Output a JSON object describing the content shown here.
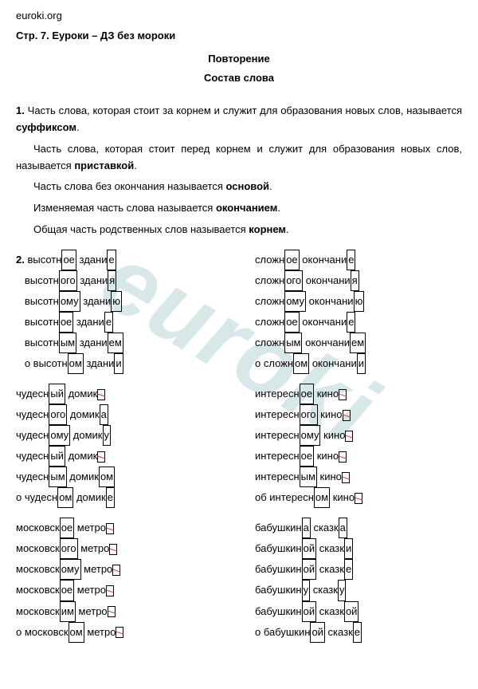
{
  "site": "euroki.org",
  "page_title": "Стр. 7. Еуроки – ДЗ без мороки",
  "heading1": "Повторение",
  "heading2": "Состав слова",
  "watermark": "euroki",
  "section1": {
    "num": "1.",
    "p1a": " Часть слова, которая стоит за корнем и служит для образования новых слов, называется ",
    "p1b": "суффиксом",
    "p1c": ".",
    "p2a": "Часть слова, которая стоит перед корнем и служит для образования новых слов, называется ",
    "p2b": "приставкой",
    "p2c": ".",
    "p3a": "Часть слова без окончания называется ",
    "p3b": "основой",
    "p3c": ".",
    "p4a": "Изменяемая часть слова называется ",
    "p4b": "окончанием",
    "p4c": ".",
    "p5a": "Общая часть родственных слов называется ",
    "p5b": "корнем",
    "p5c": "."
  },
  "section2": {
    "num": "2.",
    "groups": [
      {
        "left": [
          {
            "pre": "высотн",
            "box": "ое",
            "mid": " здани",
            "box2": "е",
            "strike": false
          },
          {
            "pre": "высотн",
            "box": "ого",
            "mid": " здани",
            "box2": "я",
            "strike": false
          },
          {
            "pre": "высотн",
            "box": "ому",
            "mid": " здани",
            "box2": "ю",
            "strike": false
          },
          {
            "pre": "высотн",
            "box": "ое",
            "mid": " здани",
            "box2": "е",
            "strike": false
          },
          {
            "pre": "высотн",
            "box": "ым",
            "mid": " здани",
            "box2": "ем",
            "strike": false
          },
          {
            "pre": "о высотн",
            "box": "ом",
            "mid": " здани",
            "box2": "и",
            "strike": false
          }
        ],
        "right": [
          {
            "pre": "сложн",
            "box": "ое",
            "mid": " окончани",
            "box2": "е",
            "strike": false
          },
          {
            "pre": "сложн",
            "box": "ого",
            "mid": " окончани",
            "box2": "я",
            "strike": false
          },
          {
            "pre": "сложн",
            "box": "ому",
            "mid": " окончани",
            "box2": "ю",
            "strike": false
          },
          {
            "pre": "сложн",
            "box": "ое",
            "mid": " окончани",
            "box2": "е",
            "strike": false
          },
          {
            "pre": "сложн",
            "box": "ым",
            "mid": " окончани",
            "box2": "ем",
            "strike": false
          },
          {
            "pre": "о сложн",
            "box": "ом",
            "mid": " окончани",
            "box2": "и",
            "strike": false
          }
        ]
      },
      {
        "left": [
          {
            "pre": "чудесн",
            "box": "ый",
            "mid": " домик",
            "box2": "",
            "strike": true
          },
          {
            "pre": "чудесн",
            "box": "ого",
            "mid": " домик",
            "box2": "а",
            "strike": false
          },
          {
            "pre": "чудесн",
            "box": "ому",
            "mid": " домик",
            "box2": "у",
            "strike": false
          },
          {
            "pre": "чудесн",
            "box": "ый",
            "mid": " домик",
            "box2": "",
            "strike": true
          },
          {
            "pre": "чудесн",
            "box": "ым",
            "mid": " домик",
            "box2": "ом",
            "strike": false
          },
          {
            "pre": "о чудесн",
            "box": "ом",
            "mid": " домик",
            "box2": "е",
            "strike": false
          }
        ],
        "right": [
          {
            "pre": "интересн",
            "box": "ое",
            "mid": " кино",
            "box2": "",
            "strike": true
          },
          {
            "pre": "интересн",
            "box": "ого",
            "mid": " кино",
            "box2": "",
            "strike": true
          },
          {
            "pre": "интересн",
            "box": "ому",
            "mid": " кино",
            "box2": "",
            "strike": true
          },
          {
            "pre": "интересн",
            "box": "ое",
            "mid": " кино",
            "box2": "",
            "strike": true
          },
          {
            "pre": "интересн",
            "box": "ым",
            "mid": " кино",
            "box2": "",
            "strike": true
          },
          {
            "pre": "об интересн",
            "box": "ом",
            "mid": " кино",
            "box2": "",
            "strike": true
          }
        ]
      },
      {
        "left": [
          {
            "pre": "московск",
            "box": "ое",
            "mid": " метро",
            "box2": "",
            "strike": true
          },
          {
            "pre": "московск",
            "box": "ого",
            "mid": " метро",
            "box2": "",
            "strike": true
          },
          {
            "pre": "московск",
            "box": "ому",
            "mid": " метро",
            "box2": "",
            "strike": true
          },
          {
            "pre": "московск",
            "box": "ое",
            "mid": " метро",
            "box2": "",
            "strike": true
          },
          {
            "pre": "московск",
            "box": "им",
            "mid": " метро",
            "box2": "",
            "strike": true
          },
          {
            "pre": "о московск",
            "box": "ом",
            "mid": " метро",
            "box2": "",
            "strike": true
          }
        ],
        "right": [
          {
            "pre": "бабушкин",
            "box": "а",
            "mid": " сказк",
            "box2": "а",
            "strike": false
          },
          {
            "pre": "бабушкин",
            "box": "ой",
            "mid": " сказк",
            "box2": "и",
            "strike": false
          },
          {
            "pre": "бабушкин",
            "box": "ой",
            "mid": " сказк",
            "box2": "е",
            "strike": false
          },
          {
            "pre": "бабушкин",
            "box": "у",
            "mid": " сказк",
            "box2": "у",
            "strike": false
          },
          {
            "pre": "бабушкин",
            "box": "ой",
            "mid": " сказк",
            "box2": "ой",
            "strike": false
          },
          {
            "pre": "о бабушкин",
            "box": "ой",
            "mid": " сказк",
            "box2": "е",
            "strike": false
          }
        ]
      }
    ]
  }
}
